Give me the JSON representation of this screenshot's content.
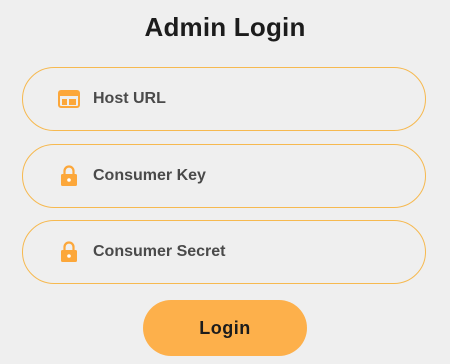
{
  "page": {
    "title": "Admin Login"
  },
  "form": {
    "fields": [
      {
        "label": "Host URL",
        "icon": "browser-window-icon"
      },
      {
        "label": "Consumer Key",
        "icon": "lock-icon"
      },
      {
        "label": "Consumer Secret",
        "icon": "lock-icon"
      }
    ],
    "submit_label": "Login"
  },
  "colors": {
    "accent": "#fdb04b",
    "field_border": "#f6b950",
    "background": "#efefef",
    "text": "#4a4a4a"
  }
}
